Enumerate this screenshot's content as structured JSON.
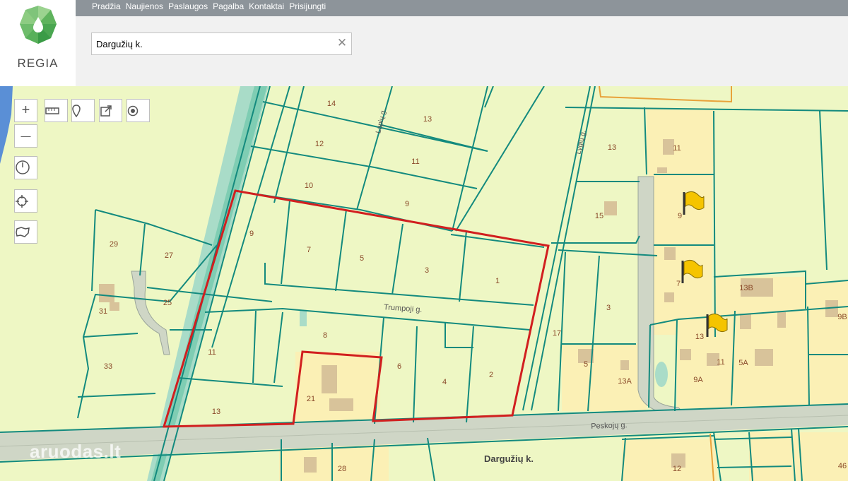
{
  "nav": {
    "links": [
      "Pradžia",
      "Naujienos",
      "Paslaugos",
      "Pagalba",
      "Kontaktai",
      "Prisijungti"
    ]
  },
  "logo": {
    "text": "REGIA"
  },
  "search": {
    "value": "Dargužių k.",
    "clear_label": "✕"
  },
  "controls": {
    "zoom_in": "+",
    "zoom_out": "—",
    "icons": [
      "zoom-in-icon",
      "zoom-out-icon",
      "ruler-icon",
      "pin-icon",
      "export-icon",
      "target-icon",
      "history-icon",
      "locate-icon",
      "area-icon"
    ]
  },
  "map": {
    "streets": [
      "Trumpoji g.",
      "Peskojų g.",
      "Lygių g.",
      "Lapių g."
    ],
    "village_label": "Dargužių k.",
    "parcel_numbers": [
      "14",
      "13",
      "12",
      "11",
      "10",
      "9",
      "9",
      "7",
      "5",
      "3",
      "1",
      "29",
      "27",
      "31",
      "25",
      "33",
      "8",
      "11",
      "6",
      "4",
      "2",
      "13",
      "21",
      "17",
      "13",
      "11",
      "15",
      "9",
      "7",
      "3",
      "9B",
      "13B",
      "13",
      "11",
      "5A",
      "5",
      "13A",
      "9A",
      "46",
      "28",
      "12"
    ],
    "colors": {
      "highlight": "#d11f1f",
      "parcel_line": "#138a7e",
      "land": "#eef7c4",
      "built": "#fbf0b5",
      "road": "#cfd6c6",
      "flag": "#f5c400"
    }
  },
  "watermark": {
    "text": "aruodas",
    "suffix": ".lt"
  }
}
